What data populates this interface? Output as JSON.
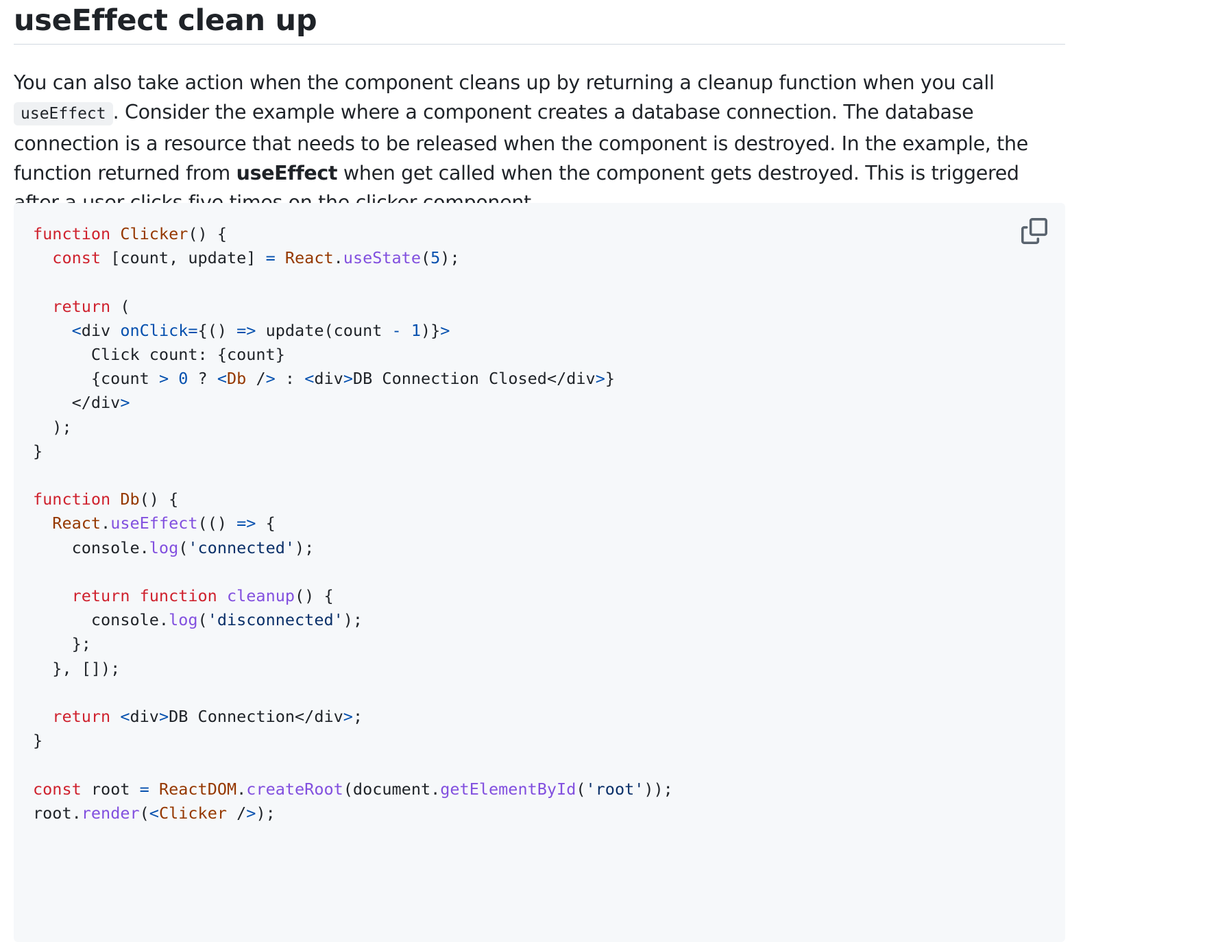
{
  "heading": "useEffect clean up",
  "paragraph": {
    "text_1": "You can also take action when the component cleans up by returning a cleanup function when you call ",
    "inline_code": "useEffect",
    "text_2": ". Consider the example where a component creates a database connection. The database connection is a resource that needs to be released when the component is destroyed. In the example, the function returned from ",
    "bold": "useEffect",
    "text_3": " when get called when the component gets destroyed. This is triggered after a user clicks five times on the clicker component."
  },
  "code_block": {
    "copy_icon": "copy-icon",
    "lines": [
      [
        [
          "function",
          "kw"
        ],
        [
          " ",
          ""
        ],
        [
          "Clicker",
          "fn"
        ],
        [
          "() {",
          ""
        ]
      ],
      [
        [
          "  ",
          ""
        ],
        [
          "const",
          "kw"
        ],
        [
          " [count, update] ",
          ""
        ],
        [
          "=",
          "pr"
        ],
        [
          " ",
          ""
        ],
        [
          "React",
          "fn"
        ],
        [
          ".",
          ""
        ],
        [
          "useState",
          "pl"
        ],
        [
          "(",
          ""
        ],
        [
          "5",
          "pr"
        ],
        [
          ");",
          ""
        ]
      ],
      [
        [
          "",
          ""
        ]
      ],
      [
        [
          "  ",
          ""
        ],
        [
          "return",
          "kw"
        ],
        [
          " (",
          ""
        ]
      ],
      [
        [
          "    ",
          ""
        ],
        [
          "<",
          "pr"
        ],
        [
          "div",
          ""
        ],
        [
          " ",
          ""
        ],
        [
          "onClick",
          "pr"
        ],
        [
          "=",
          "pr"
        ],
        [
          "{() ",
          ""
        ],
        [
          "=>",
          "pr"
        ],
        [
          " update(count ",
          ""
        ],
        [
          "-",
          "pr"
        ],
        [
          " ",
          ""
        ],
        [
          "1",
          "pr"
        ],
        [
          ")}",
          ""
        ],
        [
          ">",
          "pr"
        ]
      ],
      [
        [
          "      Click count: {count}",
          ""
        ]
      ],
      [
        [
          "      {count ",
          ""
        ],
        [
          ">",
          "pr"
        ],
        [
          " ",
          ""
        ],
        [
          "0",
          "pr"
        ],
        [
          " ? ",
          ""
        ],
        [
          "<",
          "pr"
        ],
        [
          "Db",
          "fn"
        ],
        [
          " /",
          ""
        ],
        [
          ">",
          "pr"
        ],
        [
          " : ",
          ""
        ],
        [
          "<",
          "pr"
        ],
        [
          "div",
          ""
        ],
        [
          ">",
          "pr"
        ],
        [
          "DB Connection Closed</div",
          ""
        ],
        [
          ">",
          "pr"
        ],
        [
          "}",
          ""
        ]
      ],
      [
        [
          "    </div",
          ""
        ],
        [
          ">",
          "pr"
        ]
      ],
      [
        [
          "  );",
          ""
        ]
      ],
      [
        [
          "}",
          ""
        ]
      ],
      [
        [
          "",
          ""
        ]
      ],
      [
        [
          "function",
          "kw"
        ],
        [
          " ",
          ""
        ],
        [
          "Db",
          "fn"
        ],
        [
          "() {",
          ""
        ]
      ],
      [
        [
          "  ",
          ""
        ],
        [
          "React",
          "fn"
        ],
        [
          ".",
          ""
        ],
        [
          "useEffect",
          "pl"
        ],
        [
          "(() ",
          ""
        ],
        [
          "=>",
          "pr"
        ],
        [
          " {",
          ""
        ]
      ],
      [
        [
          "    console.",
          ""
        ],
        [
          "log",
          "pl"
        ],
        [
          "(",
          ""
        ],
        [
          "'connected'",
          "st"
        ],
        [
          ");",
          ""
        ]
      ],
      [
        [
          "",
          ""
        ]
      ],
      [
        [
          "    ",
          ""
        ],
        [
          "return",
          "kw"
        ],
        [
          " ",
          ""
        ],
        [
          "function",
          "kw"
        ],
        [
          " ",
          ""
        ],
        [
          "cleanup",
          "pl"
        ],
        [
          "() {",
          ""
        ]
      ],
      [
        [
          "      console.",
          ""
        ],
        [
          "log",
          "pl"
        ],
        [
          "(",
          ""
        ],
        [
          "'disconnected'",
          "st"
        ],
        [
          ");",
          ""
        ]
      ],
      [
        [
          "    };",
          ""
        ]
      ],
      [
        [
          "  }, []);",
          ""
        ]
      ],
      [
        [
          "",
          ""
        ]
      ],
      [
        [
          "  ",
          ""
        ],
        [
          "return",
          "kw"
        ],
        [
          " ",
          ""
        ],
        [
          "<",
          "pr"
        ],
        [
          "div",
          ""
        ],
        [
          ">",
          "pr"
        ],
        [
          "DB Connection</div",
          ""
        ],
        [
          ">",
          "pr"
        ],
        [
          ";",
          ""
        ]
      ],
      [
        [
          "}",
          ""
        ]
      ],
      [
        [
          "",
          ""
        ]
      ],
      [
        [
          "const",
          "kw"
        ],
        [
          " root ",
          ""
        ],
        [
          "=",
          "pr"
        ],
        [
          " ",
          ""
        ],
        [
          "ReactDOM",
          "fn"
        ],
        [
          ".",
          ""
        ],
        [
          "createRoot",
          "pl"
        ],
        [
          "(document.",
          ""
        ],
        [
          "getElementById",
          "pl"
        ],
        [
          "(",
          ""
        ],
        [
          "'root'",
          "st"
        ],
        [
          "));",
          ""
        ]
      ],
      [
        [
          "root.",
          ""
        ],
        [
          "render",
          "pl"
        ],
        [
          "(",
          ""
        ],
        [
          "<",
          "pr"
        ],
        [
          "Clicker",
          "fn"
        ],
        [
          " /",
          ""
        ],
        [
          ">",
          "pr"
        ],
        [
          ");",
          ""
        ]
      ]
    ]
  }
}
